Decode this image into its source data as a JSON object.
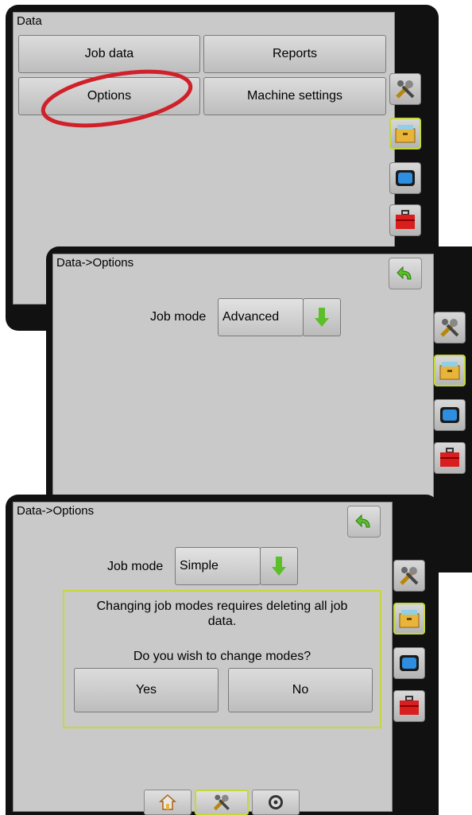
{
  "screen1": {
    "title": "Data",
    "buttons": [
      "Job data",
      "Reports",
      "Options",
      "Machine settings"
    ]
  },
  "screen2": {
    "title": "Data->Options",
    "job_mode_label": "Job mode",
    "job_mode_value": "Advanced"
  },
  "screen3": {
    "title": "Data->Options",
    "job_mode_label": "Job mode",
    "job_mode_value": "Simple",
    "dialog": {
      "message_line1": "Changing job modes requires deleting all job",
      "message_line2": "data.",
      "question": "Do you wish to change modes?",
      "yes": "Yes",
      "no": "No"
    }
  },
  "sidebar_icons": [
    "tools-icon",
    "data-folder-icon",
    "display-icon",
    "toolbox-icon"
  ],
  "bottom_tabs": [
    "home-icon",
    "tools-icon",
    "gauge-icon"
  ],
  "colors": {
    "accent": "#c4d83a",
    "highlight_circle": "#d0202a",
    "arrow": "#5cbf2a"
  }
}
